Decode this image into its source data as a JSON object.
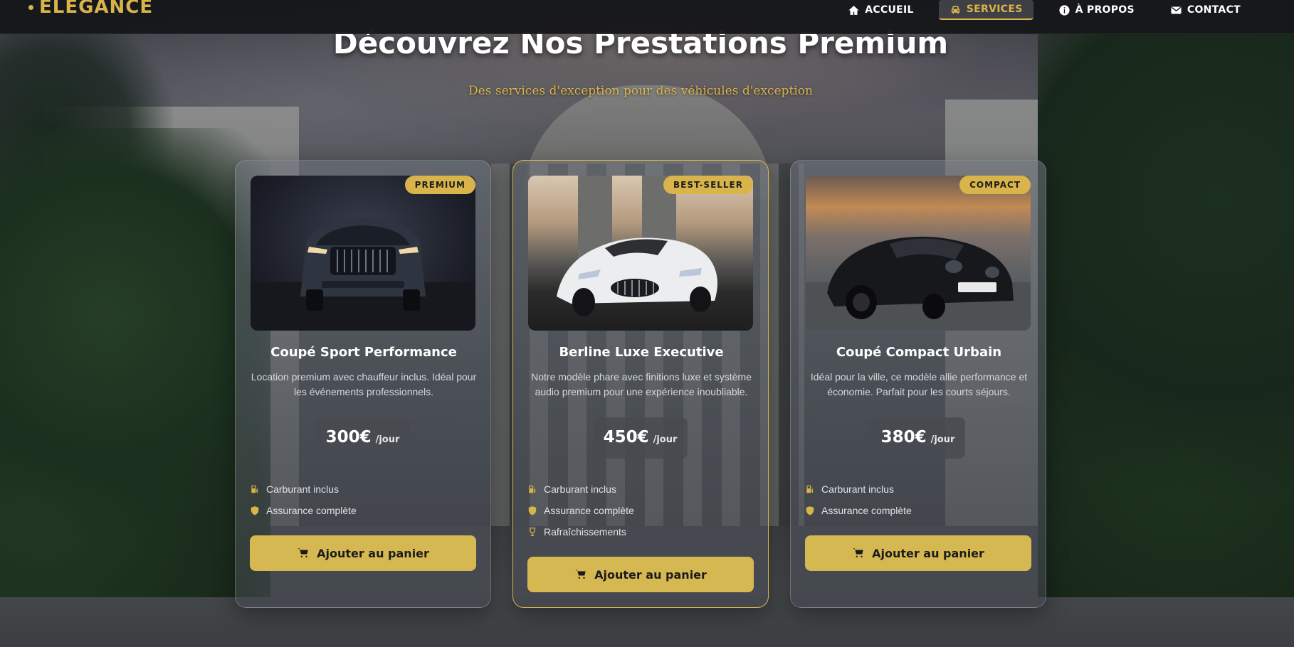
{
  "brand": {
    "name": "ÉLÉGANCE",
    "color": "#d9b44a"
  },
  "nav": {
    "items": [
      {
        "label": "ACCUEIL",
        "icon": "home-icon",
        "active": false
      },
      {
        "label": "SERVICES",
        "icon": "car-icon",
        "active": true
      },
      {
        "label": "À PROPOS",
        "icon": "info-icon",
        "active": false
      },
      {
        "label": "CONTACT",
        "icon": "envelope-icon",
        "active": false
      }
    ]
  },
  "hero": {
    "title": "Découvrez Nos Prestations Premium",
    "subtitle": "Des services d'exception pour des véhicules d'exception"
  },
  "cards": [
    {
      "badge": "PREMIUM",
      "title": "Coupé Sport Performance",
      "description": "Location premium avec chauffeur inclus. Idéal pour les événements professionnels.",
      "price": "300€",
      "price_unit": "/jour",
      "features": [
        {
          "icon": "gas-pump-icon",
          "label": "Carburant inclus"
        },
        {
          "icon": "shield-icon",
          "label": "Assurance complète"
        }
      ],
      "button": "Ajouter au panier",
      "image": "dark-suv-photo"
    },
    {
      "badge": "BEST-SELLER",
      "title": "Berline Luxe Executive",
      "description": "Notre modèle phare avec finitions luxe et système audio premium pour une expérience inoubliable.",
      "price": "450€",
      "price_unit": "/jour",
      "features": [
        {
          "icon": "gas-pump-icon",
          "label": "Carburant inclus"
        },
        {
          "icon": "shield-icon",
          "label": "Assurance complète"
        },
        {
          "icon": "glass-icon",
          "label": "Rafraîchissements"
        }
      ],
      "button": "Ajouter au panier",
      "featured": true,
      "image": "white-coupe-photo"
    },
    {
      "badge": "COMPACT",
      "title": "Coupé Compact Urbain",
      "description": "Idéal pour la ville, ce modèle allie performance et économie. Parfait pour les courts séjours.",
      "price": "380€",
      "price_unit": "/jour",
      "features": [
        {
          "icon": "gas-pump-icon",
          "label": "Carburant inclus"
        },
        {
          "icon": "shield-icon",
          "label": "Assurance complète"
        }
      ],
      "button": "Ajouter au panier",
      "image": "black-sports-car-photo"
    }
  ],
  "colors": {
    "accent": "#d9b44a",
    "button": "#d5b852",
    "navbar": "#161719"
  }
}
